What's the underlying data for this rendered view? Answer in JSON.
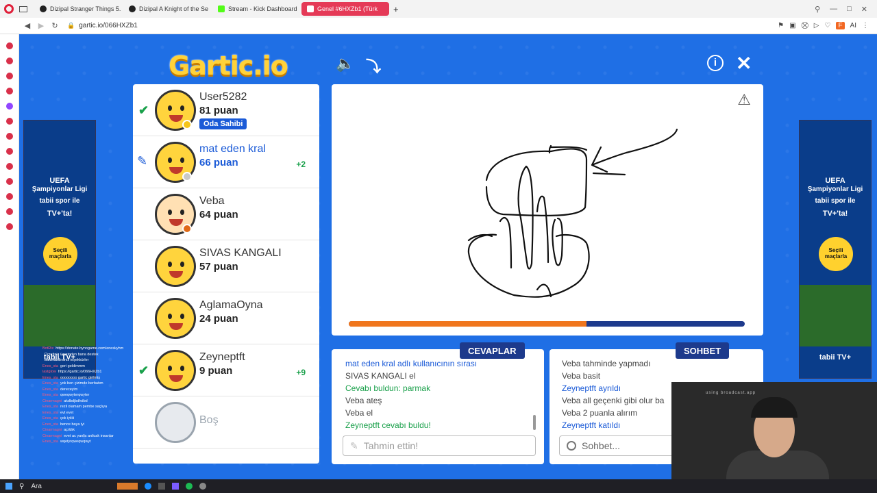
{
  "browser": {
    "tabs": [
      {
        "label": "Dizipal Stranger Things 5.",
        "active": false
      },
      {
        "label": "Dizipal A Knight of the Se",
        "active": false
      },
      {
        "label": "Stream - Kick Dashboard",
        "active": false
      },
      {
        "label": "Genel #6HXZb1 (Türk",
        "active": true
      }
    ],
    "url": "gartic.io/066HXZb1"
  },
  "game": {
    "logo": "Gartic.io",
    "players": [
      {
        "name": "User5282",
        "score": "81 puan",
        "badge": "Oda Sahibi",
        "status": "guessed",
        "gain": "",
        "dot": "#f5c518"
      },
      {
        "name": "mat eden kral",
        "score": "66 puan",
        "badge": "",
        "status": "drawing",
        "gain": "+2",
        "dot": "#c9c9c9"
      },
      {
        "name": "Veba",
        "score": "64 puan",
        "badge": "",
        "status": "",
        "gain": "",
        "dot": "#e06a18"
      },
      {
        "name": "SIVAS KANGALI",
        "score": "57 puan",
        "badge": "",
        "status": "",
        "gain": "",
        "dot": ""
      },
      {
        "name": "AglamaOyna",
        "score": "24 puan",
        "badge": "",
        "status": "",
        "gain": "",
        "dot": ""
      },
      {
        "name": "Zeyneptft",
        "score": "9 puan",
        "badge": "",
        "status": "guessed",
        "gain": "+9",
        "dot": ""
      },
      {
        "name": "Boş",
        "score": "",
        "badge": "",
        "status": "empty",
        "gain": "",
        "dot": ""
      }
    ],
    "progress": 0.6,
    "answers_tab": "CEVAPLAR",
    "chat_tab": "SOHBET",
    "answers": [
      {
        "text": "mat eden kral adlı kullanıcının sırası",
        "style": "blue"
      },
      {
        "text": "SIVAS KANGALI el",
        "style": ""
      },
      {
        "text": "Cevabı buldun: parmak",
        "style": "green"
      },
      {
        "text": "Veba ateş",
        "style": ""
      },
      {
        "text": "Veba el",
        "style": ""
      },
      {
        "text": "Zeyneptft cevabı buldu!",
        "style": "green"
      }
    ],
    "chat": [
      {
        "text": "Veba tahminde yapmadı",
        "style": ""
      },
      {
        "text": "Veba basit",
        "style": ""
      },
      {
        "text": "Zeyneptft ayrıldı",
        "style": "blue"
      },
      {
        "text": "Veba all geçenki gibi olur ba",
        "style": ""
      },
      {
        "text": "Veba 2 puanla alırım",
        "style": ""
      },
      {
        "text": "Zeyneptft katıldı",
        "style": "blue"
      }
    ],
    "guess_placeholder": "Tahmin ettin!",
    "chat_placeholder": "Sohbet..."
  },
  "ads": {
    "line1": "UEFA",
    "line2": "Şampiyonlar Ligi",
    "line3": "tabii spor ile",
    "line4": "TV+'ta!",
    "circle": "Seçili maçlarla",
    "brand": "tabii TV+"
  },
  "stream_chat": [
    {
      "user": "BotRix",
      "text": "https://donate.bynogame.com/eneskyhm"
    },
    {
      "user": "",
      "text": "Ücretiniz üzerinden bana destek"
    },
    {
      "user": "",
      "text": "bulunabilirsiniz teşekkürler"
    },
    {
      "user": "Enes_sta",
      "text": "geri geldimmm"
    },
    {
      "user": "lastglow",
      "text": "https://gartic.io/066HXZb1"
    },
    {
      "user": "Enes_sta",
      "text": "oooooooo gartic girilmiş"
    },
    {
      "user": "Enes_sta",
      "text": "yok ben çizimde berbatım"
    },
    {
      "user": "Enes_sta",
      "text": "dereceyim"
    },
    {
      "user": "Enes_sta",
      "text": "qweqwyterqwyter"
    },
    {
      "user": "Cinarmagni",
      "text": "akdbdjbdhdbd"
    },
    {
      "user": "Enes_sta",
      "text": "rezil olamam pembe saçlıya"
    },
    {
      "user": "Enes_sta",
      "text": "evt evet"
    },
    {
      "user": "Enes_sta",
      "text": "çok iyiiiii"
    },
    {
      "user": "Enes_sta",
      "text": "bence baya iyi"
    },
    {
      "user": "Cinarmagni",
      "text": "açıldık"
    },
    {
      "user": "Cinarmagni",
      "text": "evet ac yanlis anlicak insanlar"
    },
    {
      "user": "Enes_sta",
      "text": "wqetyrqweqwqwyt"
    }
  ],
  "webcam_text": "using broadcast.app",
  "taskbar": {
    "search": "Ara"
  },
  "colors": {
    "bg": "#1f6fe5",
    "brand": "#ffd23a",
    "navy": "#1d3a8c",
    "accent": "#e53a57"
  }
}
